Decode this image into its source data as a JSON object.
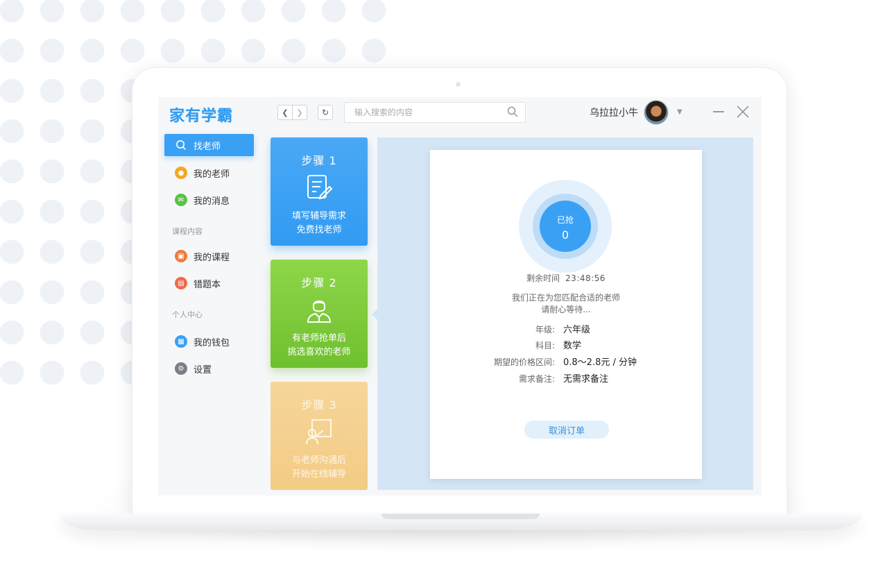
{
  "app": {
    "logo": "家有学霸",
    "search": {
      "placeholder": "输入搜索的内容"
    },
    "user": {
      "name": "乌拉拉小牛"
    },
    "colors": {
      "accent": "#3aa0f4",
      "green": "#6fc02f",
      "orange": "#f3cb85"
    }
  },
  "sidebar": {
    "items": [
      {
        "label": "找老师",
        "icon": "search-icon"
      },
      {
        "label": "我的老师",
        "icon": "teacher-icon"
      },
      {
        "label": "我的消息",
        "icon": "message-icon"
      }
    ],
    "section_courses": "课程内容",
    "course_items": [
      {
        "label": "我的课程",
        "icon": "course-icon"
      },
      {
        "label": "错题本",
        "icon": "notebook-icon"
      }
    ],
    "section_personal": "个人中心",
    "personal_items": [
      {
        "label": "我的钱包",
        "icon": "wallet-icon"
      },
      {
        "label": "设置",
        "icon": "gear-icon"
      }
    ]
  },
  "steps": [
    {
      "title": "步骤 1",
      "line1": "填写辅导需求",
      "line2": "免费找老师"
    },
    {
      "title": "步骤 2",
      "line1": "有老师抢单后",
      "line2": "挑选喜欢的老师"
    },
    {
      "title": "步骤 3",
      "line1": "与老师沟通后",
      "line2": "开始在线辅导"
    }
  ],
  "order": {
    "grab_label": "已抢",
    "grab_count": "0",
    "remain_label": "剩余时间",
    "remain_time": "23:48:56",
    "matching_line1": "我们正在为您匹配合适的老师",
    "matching_line2": "请耐心等待...",
    "grade_label": "年级:",
    "grade_value": "六年级",
    "subject_label": "科目:",
    "subject_value": "数学",
    "price_label": "期望的价格区间:",
    "price_value": "0.8～2.8元 / 分钟",
    "note_label": "需求备注:",
    "note_value": "无需求备注",
    "cancel_label": "取消订单"
  }
}
